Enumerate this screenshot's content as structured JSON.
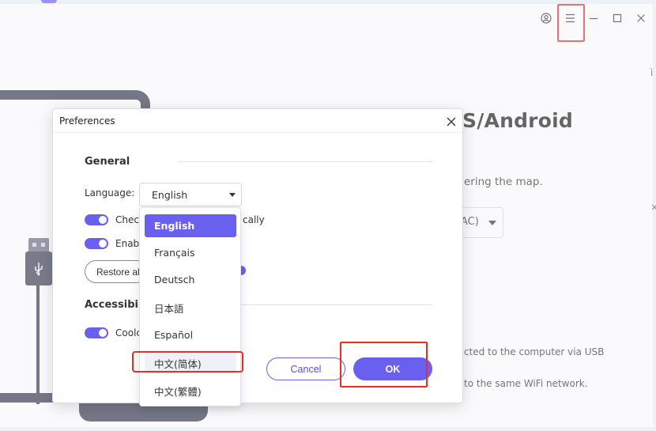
{
  "app": {
    "heading": "S/Android",
    "subtext": "ering the map.",
    "device_select_value": "AC)",
    "usb_text": "cted to the computer via USB",
    "wifi_text": "to the same WiFi network.",
    "edge_glyph_1": "ì",
    "edge_glyph_2": "×"
  },
  "window_controls": [
    "user-icon",
    "menu-icon",
    "minimize-icon",
    "maximize-icon",
    "close-icon"
  ],
  "dialog": {
    "title": "Preferences",
    "general_title": "General",
    "language_label": "Language:",
    "language_value": "English",
    "toggle1_text_a": "Check",
    "toggle1_text_b": "cally",
    "toggle2_text": "Enabl",
    "restore_label": "Restore all",
    "accessibility_title": "Accessibilit",
    "toggle3_text": "Coolc",
    "cancel_label": "Cancel",
    "ok_label": "OK"
  },
  "language_options": [
    "English",
    "Français",
    "Deutsch",
    "日本語",
    "Español",
    "中文(简体)",
    "中文(繁體)"
  ],
  "colors": {
    "accent": "#6a60f0",
    "highlight": "#e0302a",
    "illustration": "#33364a"
  }
}
